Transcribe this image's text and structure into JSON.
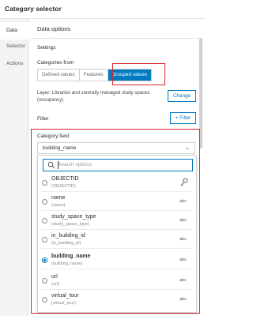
{
  "header": {
    "title": "Category selector"
  },
  "sidebar": {
    "items": [
      {
        "label": "Data",
        "active": true
      },
      {
        "label": "Selector",
        "active": false
      },
      {
        "label": "Actions",
        "active": false
      }
    ]
  },
  "panel": {
    "title": "Data options",
    "settings_label": "Settings",
    "categories_from_label": "Categories from",
    "segments": [
      {
        "label": "Defined values",
        "active": false
      },
      {
        "label": "Features",
        "active": false
      },
      {
        "label": "Grouped values",
        "active": true
      }
    ],
    "layer_text": "Layer: Libraries and centrally managed study spaces (occupancy)",
    "change_label": "Change",
    "filter_label": "Filter",
    "add_filter_label": "+ Filter",
    "category_field_label": "Category field",
    "category_field_value": "building_name"
  },
  "dropdown": {
    "search_placeholder": "Search options",
    "options": [
      {
        "name": "OBJECTID",
        "alias": "(OBJECTID)",
        "type_icon": "key-icon",
        "type_label": "",
        "selected": false
      },
      {
        "name": "name",
        "alias": "(name)",
        "type_icon": "string-type",
        "type_label": "abc",
        "selected": false
      },
      {
        "name": "study_space_type",
        "alias": "(study_space_type)",
        "type_icon": "string-type",
        "type_label": "abc",
        "selected": false
      },
      {
        "name": "in_building_id",
        "alias": "(in_building_id)",
        "type_icon": "string-type",
        "type_label": "abc",
        "selected": false
      },
      {
        "name": "building_name",
        "alias": "(building_name)",
        "type_icon": "string-type",
        "type_label": "abc",
        "selected": true
      },
      {
        "name": "url",
        "alias": "(url)",
        "type_icon": "string-type",
        "type_label": "abc",
        "selected": false
      },
      {
        "name": "virtual_tour",
        "alias": "(virtual_tour)",
        "type_icon": "string-type",
        "type_label": "abc",
        "selected": false
      }
    ]
  },
  "colors": {
    "accent": "#0079c1",
    "highlight_border": "#d6232a",
    "sidebar_bg": "#f3f3f3"
  }
}
